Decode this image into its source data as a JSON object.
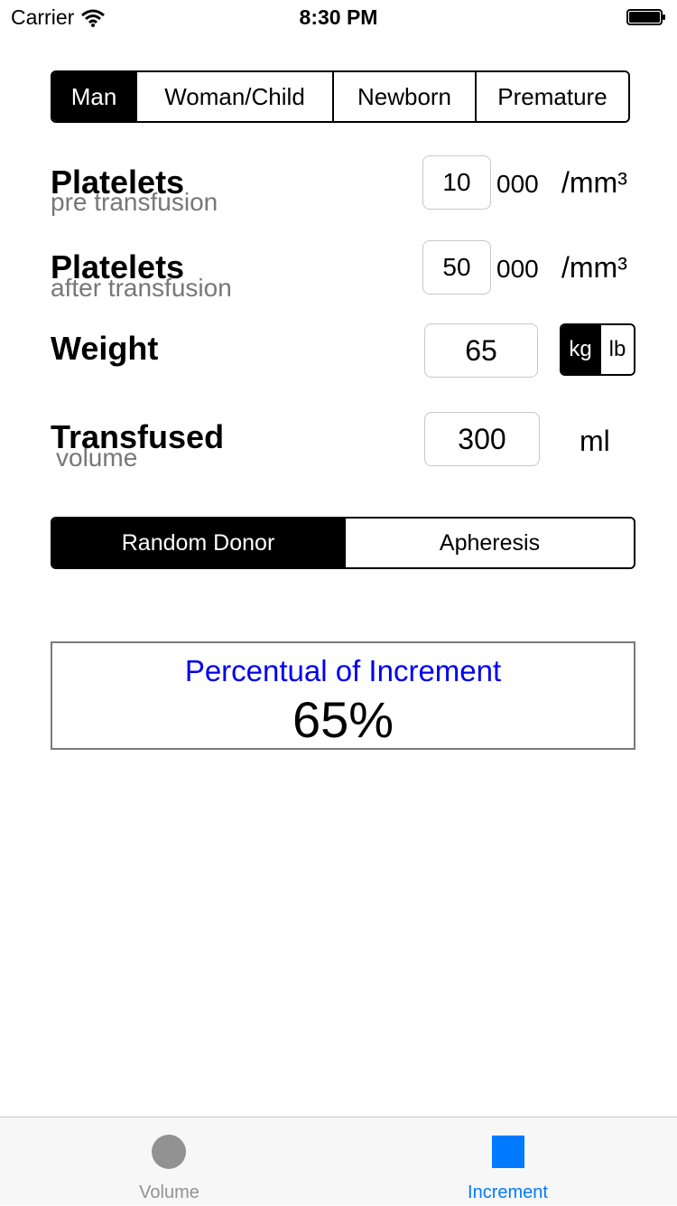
{
  "status_bar": {
    "carrier": "Carrier",
    "time": "8:30 PM"
  },
  "patient_type": {
    "options": [
      "Man",
      "Woman/Child",
      "Newborn",
      "Premature"
    ],
    "selected": "Man"
  },
  "platelets_pre": {
    "label": "Platelets",
    "sublabel": "pre transfusion",
    "value": "10",
    "suffix": "000",
    "unit": "/mm³"
  },
  "platelets_post": {
    "label": "Platelets",
    "sublabel": "after transfusion",
    "value": "50",
    "suffix": "000",
    "unit": "/mm³"
  },
  "weight": {
    "label": "Weight",
    "value": "65",
    "units": [
      "kg",
      "lb"
    ],
    "selected_unit": "kg"
  },
  "transfused": {
    "label": "Transfused",
    "sublabel": "volume",
    "value": "300",
    "unit": "ml"
  },
  "donor_type": {
    "options": [
      "Random Donor",
      "Apheresis"
    ],
    "selected": "Random Donor"
  },
  "result": {
    "title": "Percentual of Increment",
    "value": "65%"
  },
  "tab_bar": {
    "tabs": [
      {
        "label": "Volume",
        "icon": "circle-icon",
        "active": false
      },
      {
        "label": "Increment",
        "icon": "square-icon",
        "active": true
      }
    ],
    "active_color": "#007aff",
    "inactive_color": "#929292"
  }
}
